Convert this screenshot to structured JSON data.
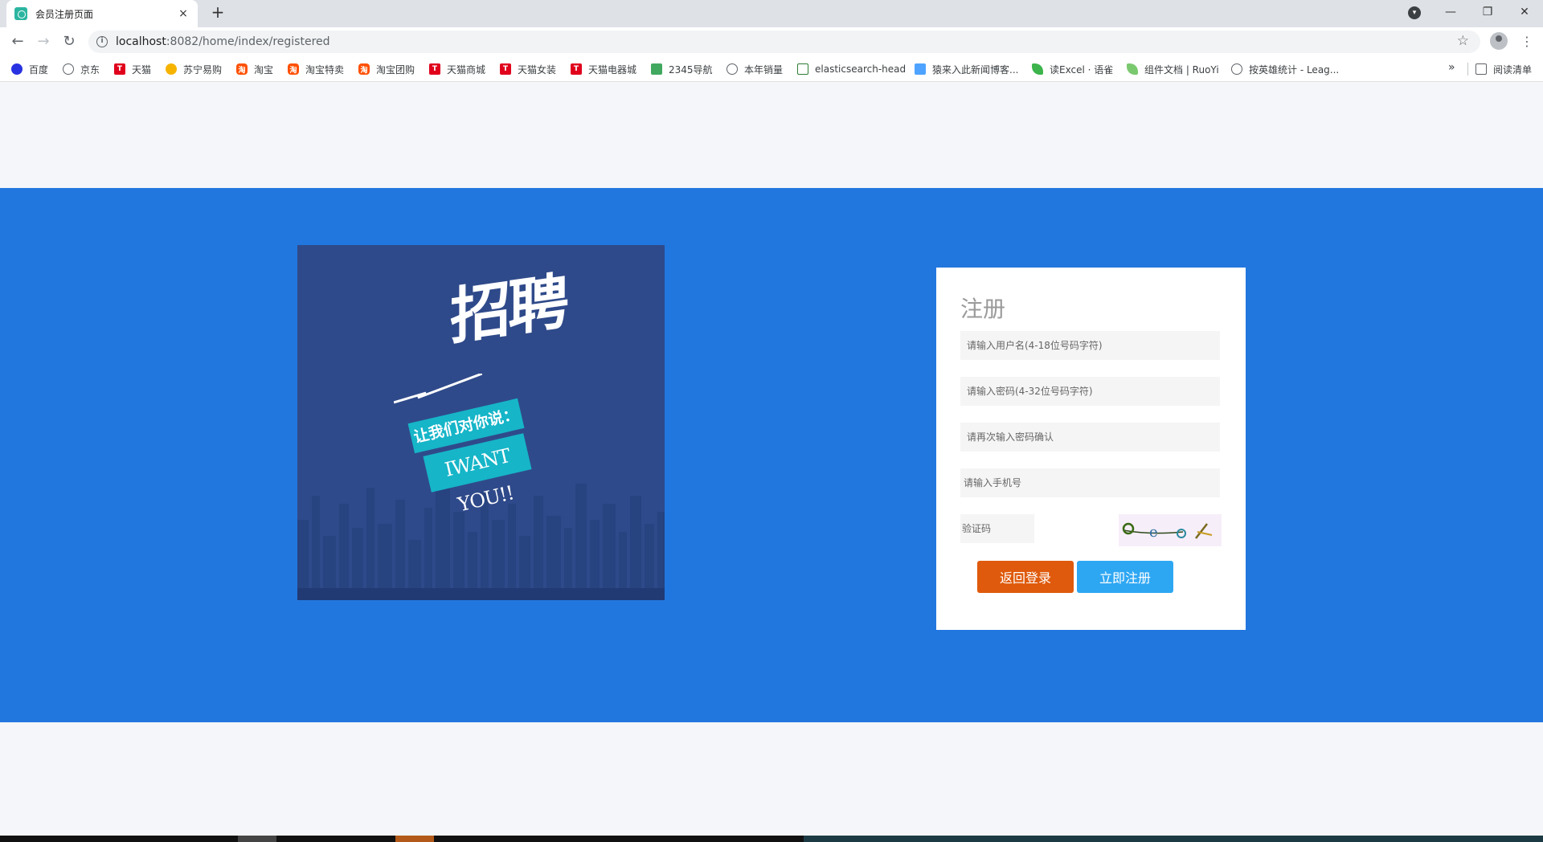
{
  "browser": {
    "tab_title": "会员注册页面",
    "tab_close": "×",
    "new_tab": "+",
    "url_host": "localhost",
    "url_rest": ":8082/home/index/registered",
    "window": {
      "minimize": "—",
      "restore": "❐",
      "close": "✕"
    }
  },
  "bookmarks": {
    "items": [
      {
        "label": "百度",
        "icon": "baidu-icon"
      },
      {
        "label": "京东",
        "icon": "globe-icon"
      },
      {
        "label": "天猫",
        "icon": "tmall-icon"
      },
      {
        "label": "苏宁易购",
        "icon": "suning-icon"
      },
      {
        "label": "淘宝",
        "icon": "taobao-icon"
      },
      {
        "label": "淘宝特卖",
        "icon": "taobao-icon"
      },
      {
        "label": "淘宝团购",
        "icon": "taobao-icon"
      },
      {
        "label": "天猫商城",
        "icon": "tmall-icon"
      },
      {
        "label": "天猫女装",
        "icon": "tmall-icon"
      },
      {
        "label": "天猫电器城",
        "icon": "tmall-icon"
      },
      {
        "label": "2345导航",
        "icon": "2345-icon"
      },
      {
        "label": "本年销量",
        "icon": "globe-icon"
      },
      {
        "label": "elasticsearch-head",
        "icon": "es-icon"
      },
      {
        "label": "猿来入此新闻博客...",
        "icon": "ape-icon"
      },
      {
        "label": "读Excel · 语雀",
        "icon": "yuque-icon"
      },
      {
        "label": "组件文档 | RuoYi",
        "icon": "ruoyi-icon"
      },
      {
        "label": "按英雄统计 - Leag...",
        "icon": "globe-icon"
      }
    ],
    "more": "»",
    "reading_list": "阅读清单"
  },
  "poster": {
    "title": "招聘",
    "slogan": "让我们对你说：",
    "tagline": "IWANT YOU!!"
  },
  "form": {
    "title": "注册",
    "username_placeholder": "请输入用户名(4-18位号码字符)",
    "password_placeholder": "请输入密码(4-32位号码字符)",
    "confirm_placeholder": "请再次输入密码确认",
    "phone_placeholder": "请输入手机号",
    "captcha_placeholder": "验证码",
    "back_label": "返回登录",
    "register_label": "立即注册"
  },
  "colors": {
    "hero_bg": "#2277df",
    "poster_bg": "#2f4a8a",
    "back_button": "#df5a0c",
    "register_button": "#2ea7f3"
  }
}
